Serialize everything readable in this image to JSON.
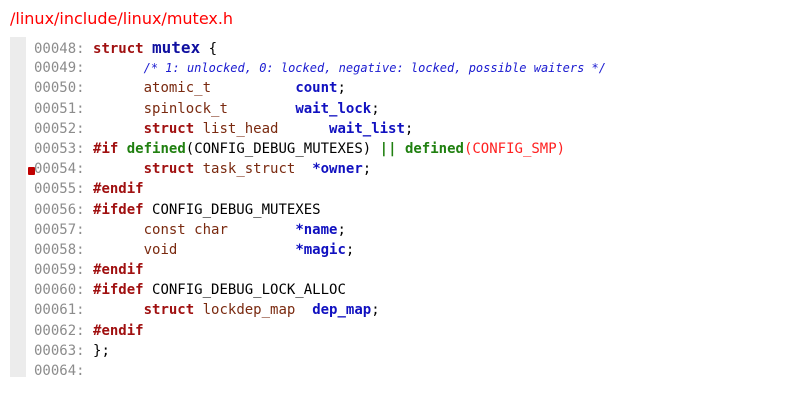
{
  "file_path": "/linux/include/linux/mutex.h",
  "code_lines": [
    {
      "no": "00048:",
      "parts": [
        [
          "kw",
          "struct"
        ],
        [
          "txt",
          " "
        ],
        [
          "struct-name",
          "mutex"
        ],
        [
          "txt",
          " "
        ],
        [
          "punc",
          "{"
        ]
      ]
    },
    {
      "no": "00049:",
      "parts": [
        [
          "txt",
          "      "
        ],
        [
          "cm",
          "/* 1: unlocked, 0: locked, negative: locked, possible waiters */"
        ]
      ]
    },
    {
      "no": "00050:",
      "parts": [
        [
          "txt",
          "      "
        ],
        [
          "ty",
          "atomic_t"
        ],
        [
          "txt",
          "          "
        ],
        [
          "idb",
          "count"
        ],
        [
          "punc",
          ";"
        ]
      ]
    },
    {
      "no": "00051:",
      "parts": [
        [
          "txt",
          "      "
        ],
        [
          "ty",
          "spinlock_t"
        ],
        [
          "txt",
          "        "
        ],
        [
          "idb",
          "wait_lock"
        ],
        [
          "punc",
          ";"
        ]
      ]
    },
    {
      "no": "00052:",
      "parts": [
        [
          "txt",
          "      "
        ],
        [
          "kw",
          "struct"
        ],
        [
          "txt",
          " "
        ],
        [
          "ty",
          "list_head"
        ],
        [
          "txt",
          "      "
        ],
        [
          "idb",
          "wait_list"
        ],
        [
          "punc",
          ";"
        ]
      ]
    },
    {
      "no": "00053:",
      "parts": [
        [
          "pp",
          "#if"
        ],
        [
          "txt",
          " "
        ],
        [
          "df",
          "defined"
        ],
        [
          "punc",
          "(CONFIG_DEBUG_MUTEXES)"
        ],
        [
          "txt",
          " "
        ],
        [
          "df",
          "||"
        ],
        [
          "txt",
          " "
        ],
        [
          "df",
          "defined"
        ],
        [
          "red",
          "(CONFIG_SMP)"
        ]
      ]
    },
    {
      "no": "00054:",
      "parts": [
        [
          "txt",
          "      "
        ],
        [
          "kw",
          "struct"
        ],
        [
          "txt",
          " "
        ],
        [
          "ty",
          "task_struct"
        ],
        [
          "txt",
          "  "
        ],
        [
          "idb",
          "*owner"
        ],
        [
          "punc",
          ";"
        ]
      ]
    },
    {
      "no": "00055:",
      "parts": [
        [
          "pp",
          "#endif"
        ]
      ]
    },
    {
      "no": "00056:",
      "parts": [
        [
          "pp",
          "#ifdef"
        ],
        [
          "txt",
          " CONFIG_DEBUG_MUTEXES"
        ]
      ]
    },
    {
      "no": "00057:",
      "parts": [
        [
          "txt",
          "      "
        ],
        [
          "ty",
          "const char"
        ],
        [
          "txt",
          "        "
        ],
        [
          "idb",
          "*name"
        ],
        [
          "punc",
          ";"
        ]
      ]
    },
    {
      "no": "00058:",
      "parts": [
        [
          "txt",
          "      "
        ],
        [
          "ty",
          "void"
        ],
        [
          "txt",
          "              "
        ],
        [
          "idb",
          "*magic"
        ],
        [
          "punc",
          ";"
        ]
      ]
    },
    {
      "no": "00059:",
      "parts": [
        [
          "pp",
          "#endif"
        ]
      ]
    },
    {
      "no": "00060:",
      "parts": [
        [
          "pp",
          "#ifdef"
        ],
        [
          "txt",
          " CONFIG_DEBUG_LOCK_ALLOC"
        ]
      ]
    },
    {
      "no": "00061:",
      "parts": [
        [
          "txt",
          "      "
        ],
        [
          "kw",
          "struct"
        ],
        [
          "txt",
          " "
        ],
        [
          "ty",
          "lockdep_map"
        ],
        [
          "txt",
          "  "
        ],
        [
          "idb",
          "dep_map"
        ],
        [
          "punc",
          ";"
        ]
      ]
    },
    {
      "no": "00062:",
      "parts": [
        [
          "pp",
          "#endif"
        ]
      ]
    },
    {
      "no": "00063:",
      "parts": [
        [
          "punc",
          "};"
        ]
      ]
    },
    {
      "no": "00064:",
      "parts": []
    }
  ],
  "bookmark_line": "00054:"
}
